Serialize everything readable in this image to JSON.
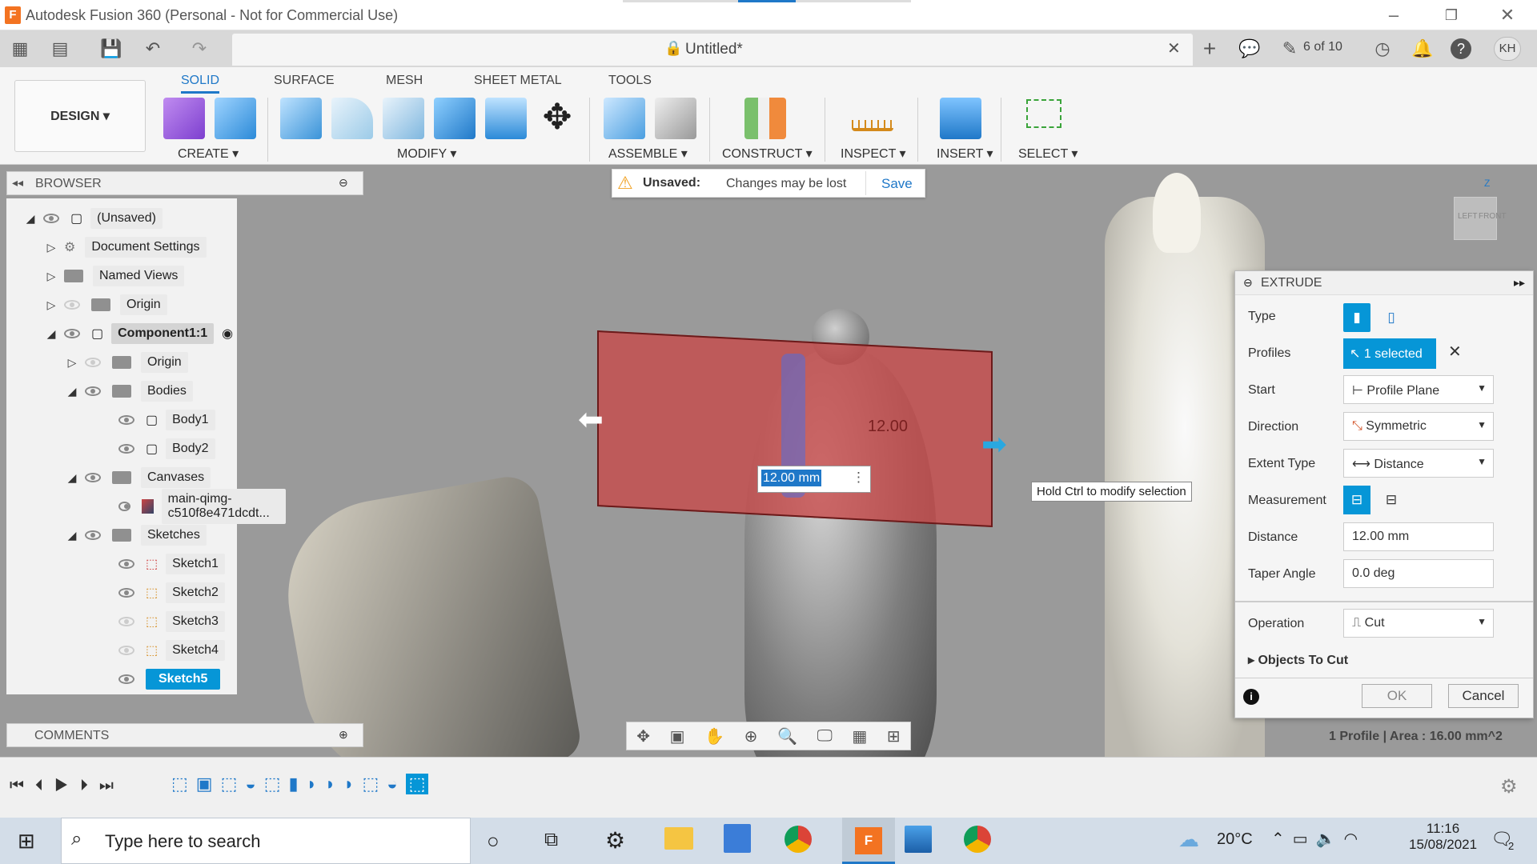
{
  "window": {
    "title": "Autodesk Fusion 360 (Personal - Not for Commercial Use)",
    "logo": "F"
  },
  "qat": {
    "doc_title": "Untitled*",
    "jobs": "6 of 10",
    "user": "KH"
  },
  "ribbon": {
    "workspace": "DESIGN",
    "tabs": [
      "SOLID",
      "SURFACE",
      "MESH",
      "SHEET METAL",
      "TOOLS"
    ],
    "groups": {
      "create": "CREATE",
      "modify": "MODIFY",
      "assemble": "ASSEMBLE",
      "construct": "CONSTRUCT",
      "inspect": "INSPECT",
      "insert": "INSERT",
      "select": "SELECT"
    }
  },
  "browser": {
    "label": "BROWSER",
    "items": {
      "root": "(Unsaved)",
      "doc_settings": "Document Settings",
      "named_views": "Named Views",
      "origin": "Origin",
      "component": "Component1:1",
      "comp_origin": "Origin",
      "bodies": "Bodies",
      "body1": "Body1",
      "body2": "Body2",
      "canvases": "Canvases",
      "canvas1": "main-qimg-c510f8e471dcdt...",
      "sketches": "Sketches",
      "sketch1": "Sketch1",
      "sketch2": "Sketch2",
      "sketch3": "Sketch3",
      "sketch4": "Sketch4",
      "sketch5": "Sketch5"
    }
  },
  "unsaved_bar": {
    "label": "Unsaved:",
    "message": "Changes may be lost",
    "save": "Save"
  },
  "viewport": {
    "dim_input": "12.00 mm",
    "dim_label": "12.00",
    "tooltip": "Hold Ctrl to modify selection",
    "status": "1 Profile | Area : 16.00 mm^2",
    "viewcube": {
      "left": "LEFT",
      "front": "FRONT",
      "axis": "Z"
    }
  },
  "comments": {
    "label": "COMMENTS"
  },
  "extrude": {
    "title": "EXTRUDE",
    "type_label": "Type",
    "profiles_label": "Profiles",
    "profiles_value": "1 selected",
    "start_label": "Start",
    "start_value": "Profile Plane",
    "direction_label": "Direction",
    "direction_value": "Symmetric",
    "extent_label": "Extent Type",
    "extent_value": "Distance",
    "measurement_label": "Measurement",
    "distance_label": "Distance",
    "distance_value": "12.00 mm",
    "taper_label": "Taper Angle",
    "taper_value": "0.0 deg",
    "operation_label": "Operation",
    "operation_value": "Cut",
    "objects_label": "Objects To Cut",
    "ok": "OK",
    "cancel": "Cancel"
  },
  "taskbar": {
    "search_placeholder": "Type here to search",
    "weather": "20°C",
    "time": "11:16",
    "date": "15/08/2021",
    "notifications": "2"
  },
  "colors": {
    "accent": "#1f78c8",
    "selected": "#0696d7",
    "extrude_body": "#c84848",
    "warning": "#f0a020"
  }
}
